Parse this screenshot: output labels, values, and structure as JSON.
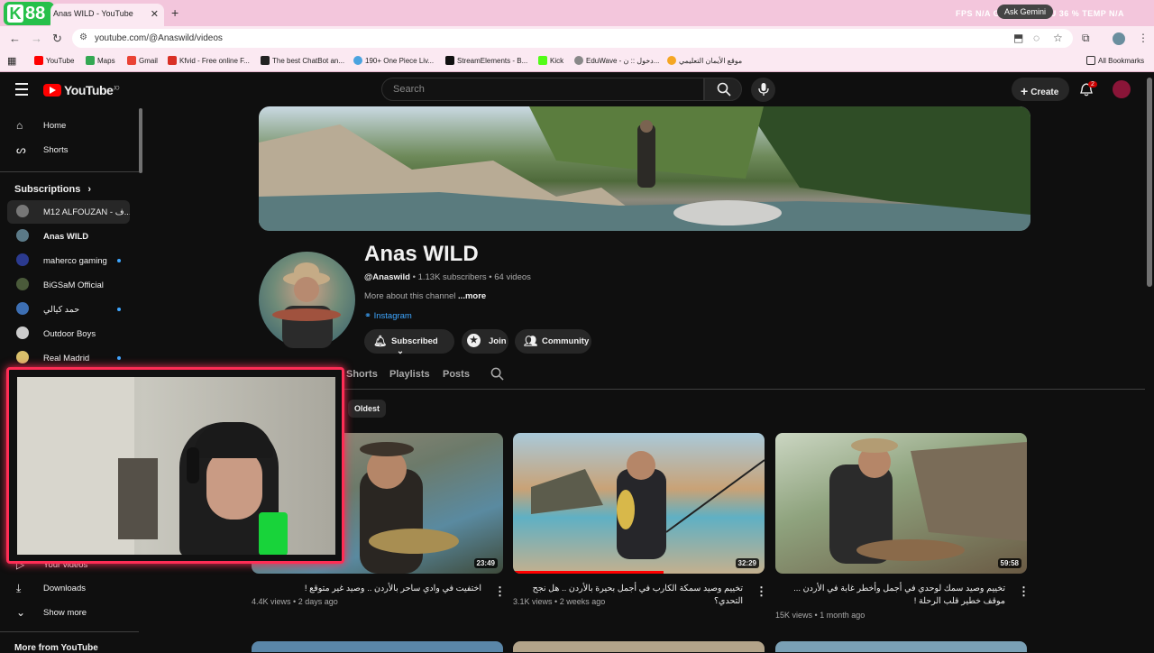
{
  "browser": {
    "tab_title": "Anas WILD - YouTube",
    "url": "youtube.com/@Anaswild/videos",
    "overlay_brand": "88",
    "overlay_brand_k": "K",
    "stats_text": "FPS N/A  GPU 13 %  CPU 36 %  TEMP N/A",
    "ask_gemini": "Ask Gemini",
    "bookmarks": [
      {
        "label": "YouTube",
        "color": "#ff0000"
      },
      {
        "label": "Maps",
        "color": "#34a853"
      },
      {
        "label": "Gmail",
        "color": "#ea4335"
      },
      {
        "label": "Kfvid - Free online F...",
        "color": "#d93025"
      },
      {
        "label": "The best ChatBot an...",
        "color": "#222222"
      },
      {
        "label": "190+ One Piece Liv...",
        "color": "#4aa3df"
      },
      {
        "label": "StreamElements - B...",
        "color": "#111111"
      },
      {
        "label": "Kick",
        "color": "#53fc18"
      },
      {
        "label": "EduWave - دخول :: ن...",
        "color": "#888888"
      },
      {
        "label": "موقع الأيمان التعليمي",
        "color": "#f5a623"
      }
    ],
    "all_bookmarks": "All Bookmarks"
  },
  "header": {
    "logo_text": "YouTube",
    "logo_region": "JO",
    "search_placeholder": "Search",
    "create_label": "Create",
    "notifications_count": "2"
  },
  "sidebar": {
    "home": "Home",
    "shorts": "Shorts",
    "subscriptions_title": "Subscriptions",
    "subscriptions": [
      {
        "label": "M12 ALFOUZAN - ف...",
        "active": true,
        "dot": false,
        "color": "#777777"
      },
      {
        "label": "Anas WILD",
        "active": false,
        "dot": false,
        "color": "#5b7a88"
      },
      {
        "label": "maherco gaming",
        "active": false,
        "dot": true,
        "color": "#2b3a8f"
      },
      {
        "label": "BiGSaM Official",
        "active": false,
        "dot": false,
        "color": "#4a5a3a"
      },
      {
        "label": "حمد كيالي",
        "active": false,
        "dot": true,
        "color": "#3d6fb3"
      },
      {
        "label": "Outdoor Boys",
        "active": false,
        "dot": false,
        "color": "#cccccc"
      },
      {
        "label": "Real Madrid",
        "active": false,
        "dot": true,
        "color": "#d9c06b"
      }
    ],
    "your_videos": "Your videos",
    "downloads": "Downloads",
    "show_more": "Show more",
    "more_from": "More from YouTube"
  },
  "channel": {
    "name": "Anas WILD",
    "handle": "@Anaswild",
    "subscribers": "1.13K subscribers",
    "videos_count": "64 videos",
    "about_prefix": "More about this channel",
    "about_more": "...more",
    "link": "Instagram",
    "subscribed_label": "Subscribed",
    "join_label": "Join",
    "community_label": "Community"
  },
  "tabs": {
    "shorts": "Shorts",
    "playlists": "Playlists",
    "posts": "Posts"
  },
  "chip_oldest": "Oldest",
  "videos": [
    {
      "title": "اختفيت في وادي ساحر بالأردن .. وصيد غير متوقع !",
      "views": "4.4K views",
      "age": "2 days ago",
      "duration": "23:49",
      "progress": 0.0
    },
    {
      "title": "تخييم وصيد سمكة الكارب في أجمل بحيرة بالأردن .. هل نجح التحدي؟",
      "views": "3.1K views",
      "age": "2 weeks ago",
      "duration": "32:29",
      "progress": 0.6
    },
    {
      "title": "تخييم وصيد سمك لوحدي في أجمل وأخطر غابة في الأردن ... موقف خطير قلب الرحلة !",
      "views": "15K views",
      "age": "1 month ago",
      "duration": "59:58",
      "progress": 0.0
    }
  ]
}
